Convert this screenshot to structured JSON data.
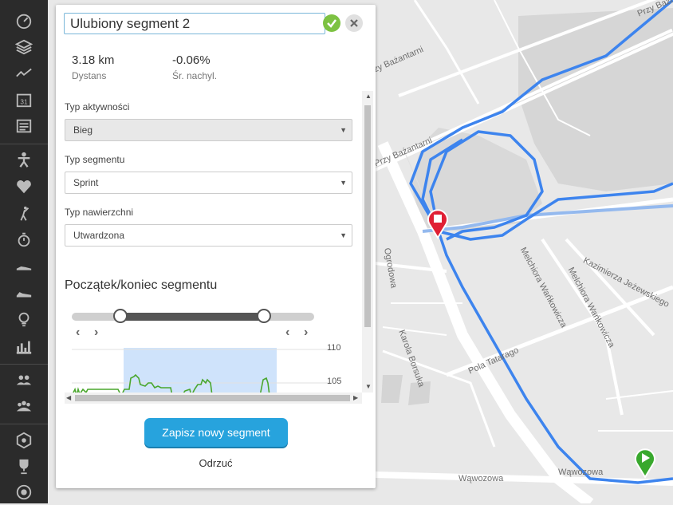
{
  "editor": {
    "name_value": "Ulubiony segment 2",
    "stats": [
      {
        "value": "3.18 km",
        "label": "Dystans"
      },
      {
        "value": "-0.06%",
        "label": "Śr. nachyl."
      }
    ],
    "activity_label": "Typ aktywności",
    "activity_value": "Bieg",
    "segment_type_label": "Typ segmentu",
    "segment_type_value": "Sprint",
    "surface_label": "Typ nawierzchni",
    "surface_value": "Utwardzona",
    "range_title": "Początek/koniec segmentu",
    "range": {
      "start_fraction": 0.2,
      "end_fraction": 0.79
    },
    "elevation_ticks": [
      "110",
      "105"
    ],
    "save_label": "Zapisz nowy segment",
    "discard_label": "Odrzuć",
    "nudge_left": "‹",
    "nudge_right": "›"
  },
  "map_labels": [
    "Przy Bażantarni",
    "Przy Bażan",
    "Przy Bażantarni",
    "Melchiora Wańkowicza",
    "Melchiora Wańkowicza",
    "Kazimierza Jeżewskiego",
    "Karola Borsuka",
    "Pola Tatarago",
    "Wąwozowa",
    "Wąwozowa",
    "Ogrodowa"
  ],
  "rail_icons": [
    "dashboard-icon",
    "layers-icon",
    "activity-icon",
    "calendar-icon",
    "news-icon",
    "person-icon",
    "heart-icon",
    "golf-icon",
    "stopwatch-icon",
    "shoe-icon",
    "sneaker-icon",
    "bulb-icon",
    "stats-icon",
    "friends-icon",
    "group-icon",
    "hexagon-icon",
    "trophy-icon",
    "target-icon"
  ],
  "colors": {
    "route": "#3d84ee",
    "accent": "#27a3dd",
    "end_marker": "#e01f34",
    "start_marker": "#38a82d",
    "range_highlight": "#cfe3fb",
    "profile_line": "#4aa72d"
  }
}
